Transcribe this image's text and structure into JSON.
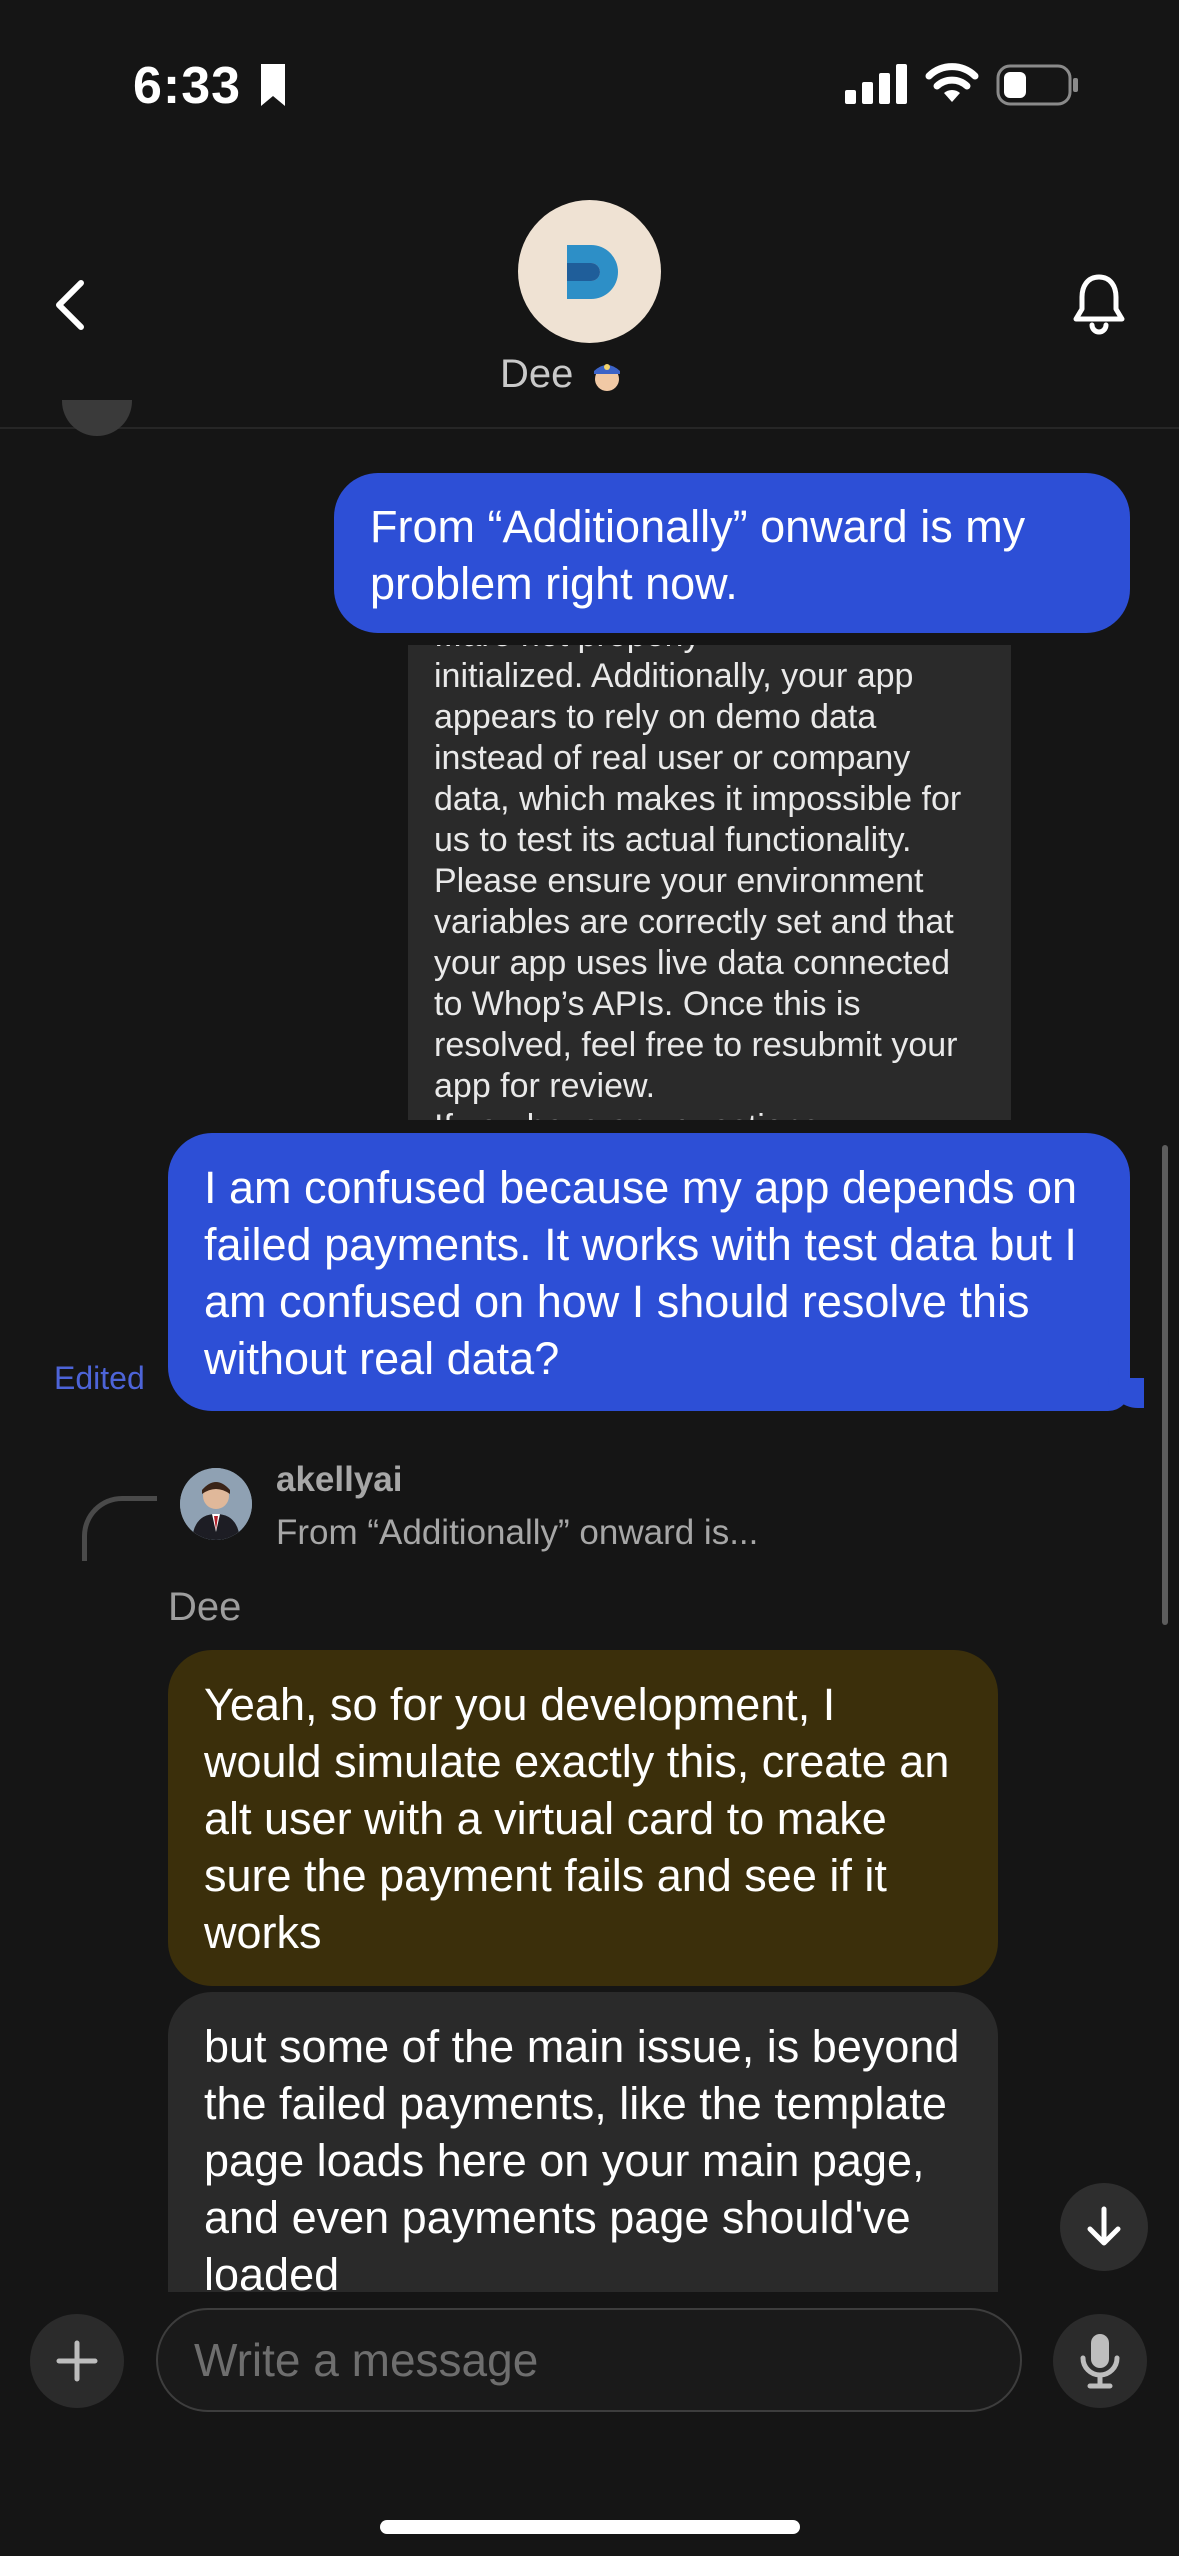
{
  "status_bar": {
    "time": "6:33"
  },
  "header": {
    "contact_name": "Dee"
  },
  "messages": {
    "sent_1": "From “Additionally” onward is my problem right now.",
    "quoted_lines": [
      "...are not properly",
      "initialized. Additionally, your app",
      "appears to rely on demo data",
      "instead of real user or company",
      "data, which makes it impossible for",
      "us to test its actual functionality.",
      "Please ensure your environment",
      "variables are correctly set and that",
      "your app uses live data connected",
      "to Whop’s APIs. Once this is",
      "resolved, feel free to resubmit your",
      "app for review.",
      "If you have any questions"
    ],
    "sent_2": "I am confused because my app depends on failed payments. It works with test data but I am confused on how I should resolve this without real data?",
    "edited_label": "Edited",
    "reply": {
      "author": "akellyai",
      "snippet": "From “Additionally” onward is..."
    },
    "sender_name": "Dee",
    "received_1": "Yeah, so for you development, I would simulate exactly this, create an alt user with a virtual card to make sure the payment fails and see if it works",
    "received_2": "but some of the main issue, is beyond the failed payments, like the template page loads here on your main page, and even payments page should've loaded"
  },
  "composer": {
    "placeholder": "Write a message"
  },
  "colors": {
    "sent_bubble": "#2d4fd6",
    "highlight_bubble": "#3b2f0b",
    "received_bubble": "#2a2a2a",
    "edited": "#4d64d8"
  }
}
